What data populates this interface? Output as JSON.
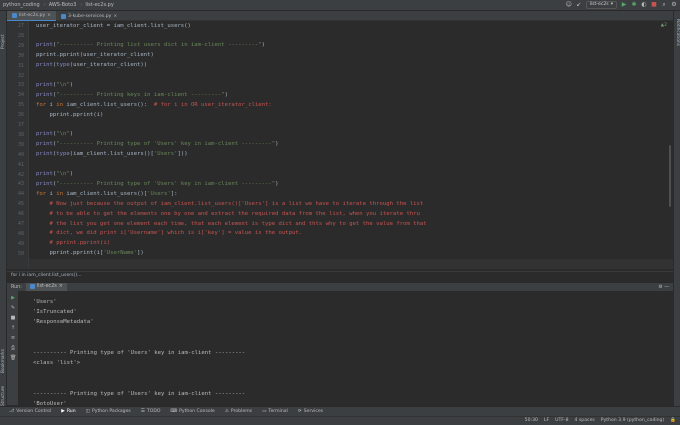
{
  "topbar": {
    "breadcrumbs": [
      "python_coding",
      "AWS-Boto3",
      "list-ec2s.py"
    ],
    "user_icon": "user-icon",
    "run_config": "list-ec2s"
  },
  "side": {
    "left_top": "Project",
    "left_bottom1": "Bookmarks",
    "left_bottom2": "Structure",
    "right_top": "Notifications"
  },
  "tabs": [
    {
      "label": "list-ec2s.py"
    },
    {
      "label": "3-kube-services.py"
    }
  ],
  "editor": {
    "warning_count": "▲2",
    "lines": [
      {
        "n": "27",
        "segs": [
          {
            "t": "user_iterator_client = iam_client.list_users()",
            "c": ""
          }
        ]
      },
      {
        "n": "28",
        "segs": []
      },
      {
        "n": "29",
        "segs": [
          {
            "t": "print",
            "c": "bi"
          },
          {
            "t": "(",
            "c": ""
          },
          {
            "t": "\"---------- Printing list users dict in iam-client ---------\"",
            "c": "str"
          },
          {
            "t": ")",
            "c": ""
          }
        ]
      },
      {
        "n": "30",
        "segs": [
          {
            "t": "pprint.pprint(user_iterator_client)",
            "c": ""
          }
        ]
      },
      {
        "n": "31",
        "segs": [
          {
            "t": "print",
            "c": "bi"
          },
          {
            "t": "(",
            "c": ""
          },
          {
            "t": "type",
            "c": "bi"
          },
          {
            "t": "(user_iterator_client))",
            "c": ""
          }
        ]
      },
      {
        "n": "32",
        "segs": []
      },
      {
        "n": "33",
        "segs": [
          {
            "t": "print",
            "c": "bi"
          },
          {
            "t": "(",
            "c": ""
          },
          {
            "t": "\"\\n\"",
            "c": "str"
          },
          {
            "t": ")",
            "c": ""
          }
        ]
      },
      {
        "n": "34",
        "segs": [
          {
            "t": "print",
            "c": "bi"
          },
          {
            "t": "(",
            "c": ""
          },
          {
            "t": "\"---------- Printing keys in iam-client ---------\"",
            "c": "str"
          },
          {
            "t": ")",
            "c": ""
          }
        ]
      },
      {
        "n": "35",
        "segs": [
          {
            "t": "for ",
            "c": "kw"
          },
          {
            "t": "i ",
            "c": ""
          },
          {
            "t": "in ",
            "c": "kw"
          },
          {
            "t": "iam_client.list_users():  ",
            "c": ""
          },
          {
            "t": "# for i in OR user_iterator_client:",
            "c": "cmred"
          }
        ]
      },
      {
        "n": "36",
        "segs": [
          {
            "t": "    pprint.pprint(i)",
            "c": ""
          }
        ]
      },
      {
        "n": "37",
        "segs": []
      },
      {
        "n": "38",
        "segs": [
          {
            "t": "print",
            "c": "bi"
          },
          {
            "t": "(",
            "c": ""
          },
          {
            "t": "\"\\n\"",
            "c": "str"
          },
          {
            "t": ")",
            "c": ""
          }
        ]
      },
      {
        "n": "39",
        "segs": [
          {
            "t": "print",
            "c": "bi"
          },
          {
            "t": "(",
            "c": ""
          },
          {
            "t": "\"---------- Printing type of 'Users' key in iam-client ---------\"",
            "c": "str"
          },
          {
            "t": ")",
            "c": ""
          }
        ]
      },
      {
        "n": "40",
        "segs": [
          {
            "t": "print",
            "c": "bi"
          },
          {
            "t": "(",
            "c": ""
          },
          {
            "t": "type",
            "c": "bi"
          },
          {
            "t": "(iam_client.list_users()[",
            "c": ""
          },
          {
            "t": "'Users'",
            "c": "str"
          },
          {
            "t": "]))",
            "c": ""
          }
        ]
      },
      {
        "n": "41",
        "segs": []
      },
      {
        "n": "42",
        "segs": [
          {
            "t": "print",
            "c": "bi"
          },
          {
            "t": "(",
            "c": ""
          },
          {
            "t": "\"\\n\"",
            "c": "str"
          },
          {
            "t": ")",
            "c": ""
          }
        ]
      },
      {
        "n": "43",
        "segs": [
          {
            "t": "print",
            "c": "bi"
          },
          {
            "t": "(",
            "c": ""
          },
          {
            "t": "\"---------- Printing type of 'Users' key in iam-client ---------\"",
            "c": "str"
          },
          {
            "t": ")",
            "c": ""
          }
        ]
      },
      {
        "n": "44",
        "segs": [
          {
            "t": "for ",
            "c": "kw"
          },
          {
            "t": "i ",
            "c": ""
          },
          {
            "t": "in ",
            "c": "kw"
          },
          {
            "t": "iam_client.list_users()[",
            "c": ""
          },
          {
            "t": "'Users'",
            "c": "str"
          },
          {
            "t": "]:",
            "c": ""
          }
        ]
      },
      {
        "n": "45",
        "segs": [
          {
            "t": "    # Now just because the output of iam_client.list_users()['Users'] is a list we have to iterate through the list",
            "c": "cmred"
          }
        ]
      },
      {
        "n": "46",
        "segs": [
          {
            "t": "    # to be able to get the elements one by one and extract the required data from the list, when you iterate thru",
            "c": "cmred"
          }
        ]
      },
      {
        "n": "47",
        "segs": [
          {
            "t": "    # the list you get one element each time, that each element is type dict and thts why to get the value from that",
            "c": "cmred"
          }
        ]
      },
      {
        "n": "48",
        "segs": [
          {
            "t": "    # dict, we did print i['Username'] which is i['key'] = value is the output.",
            "c": "cmred"
          }
        ]
      },
      {
        "n": "49",
        "segs": [
          {
            "t": "    # pprint.pprint(i)",
            "c": "cmred"
          }
        ]
      },
      {
        "n": "50",
        "segs": [
          {
            "t": "    pprint.pprint(i[",
            "c": ""
          },
          {
            "t": "'UserName'",
            "c": "str"
          },
          {
            "t": "])",
            "c": ""
          }
        ]
      }
    ]
  },
  "edit_breadcrumb": "for i in iam_client.list_users()...",
  "run": {
    "label": "Run:",
    "tab": "list-ec2s",
    "output": [
      "'Users'",
      "'IsTruncated'",
      "'ResponseMetadata'",
      "",
      "",
      "---------- Printing type of 'Users' key in iam-client ---------",
      "<class 'list'>",
      "",
      "",
      "---------- Printing type of 'Users' key in iam-client ---------",
      "'BotoUser'"
    ]
  },
  "bottom_tabs": [
    "Version Control",
    "Run",
    "Python Packages",
    "TODO",
    "Python Console",
    "Problems",
    "Terminal",
    "Services"
  ],
  "status": [
    "50:30",
    "LF",
    "UTF-8",
    "4 spaces",
    "Python 3.9 (python_coding)"
  ]
}
